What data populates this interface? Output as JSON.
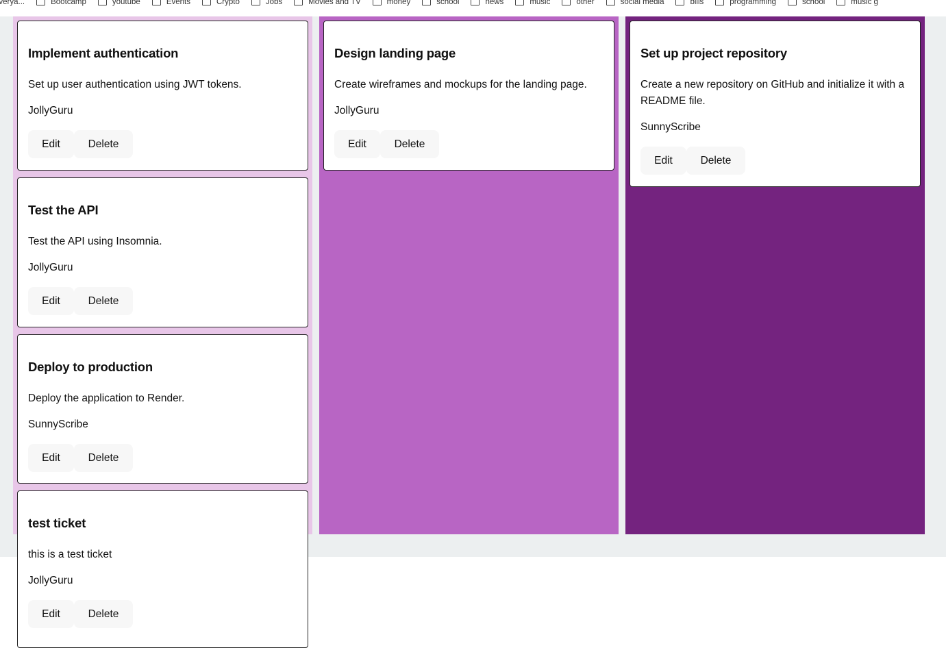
{
  "bookmarks": [
    {
      "label": "averya..."
    },
    {
      "label": "Bootcamp"
    },
    {
      "label": "youtube"
    },
    {
      "label": "Events"
    },
    {
      "label": "Crypto"
    },
    {
      "label": "Jobs"
    },
    {
      "label": "Movies and TV"
    },
    {
      "label": "money"
    },
    {
      "label": "school"
    },
    {
      "label": "news"
    },
    {
      "label": "music"
    },
    {
      "label": "other"
    },
    {
      "label": "social media"
    },
    {
      "label": "bills"
    },
    {
      "label": "programming"
    },
    {
      "label": "school"
    },
    {
      "label": "music g"
    }
  ],
  "columns": {
    "todo": {
      "color": "#e8c6e8",
      "tickets": [
        {
          "title": "Implement authentication",
          "description": "Set up user authentication using JWT tokens.",
          "owner": "JollyGuru",
          "edit_label": "Edit",
          "delete_label": "Delete"
        },
        {
          "title": "Test the API",
          "description": "Test the API using Insomnia.",
          "owner": "JollyGuru",
          "edit_label": "Edit",
          "delete_label": "Delete"
        },
        {
          "title": "Deploy to production",
          "description": "Deploy the application to Render.",
          "owner": "SunnyScribe",
          "edit_label": "Edit",
          "delete_label": "Delete"
        },
        {
          "title": "test ticket",
          "description": "this is a test ticket",
          "owner": "JollyGuru",
          "edit_label": "Edit",
          "delete_label": "Delete"
        }
      ]
    },
    "in_progress": {
      "color": "#b865c4",
      "tickets": [
        {
          "title": "Design landing page",
          "description": "Create wireframes and mockups for the landing page.",
          "owner": "JollyGuru",
          "edit_label": "Edit",
          "delete_label": "Delete"
        }
      ]
    },
    "done": {
      "color": "#74237f",
      "tickets": [
        {
          "title": "Set up project repository",
          "description": "Create a new repository on GitHub and initialize it with a README file.",
          "owner": "SunnyScribe",
          "edit_label": "Edit",
          "delete_label": "Delete"
        }
      ]
    }
  }
}
